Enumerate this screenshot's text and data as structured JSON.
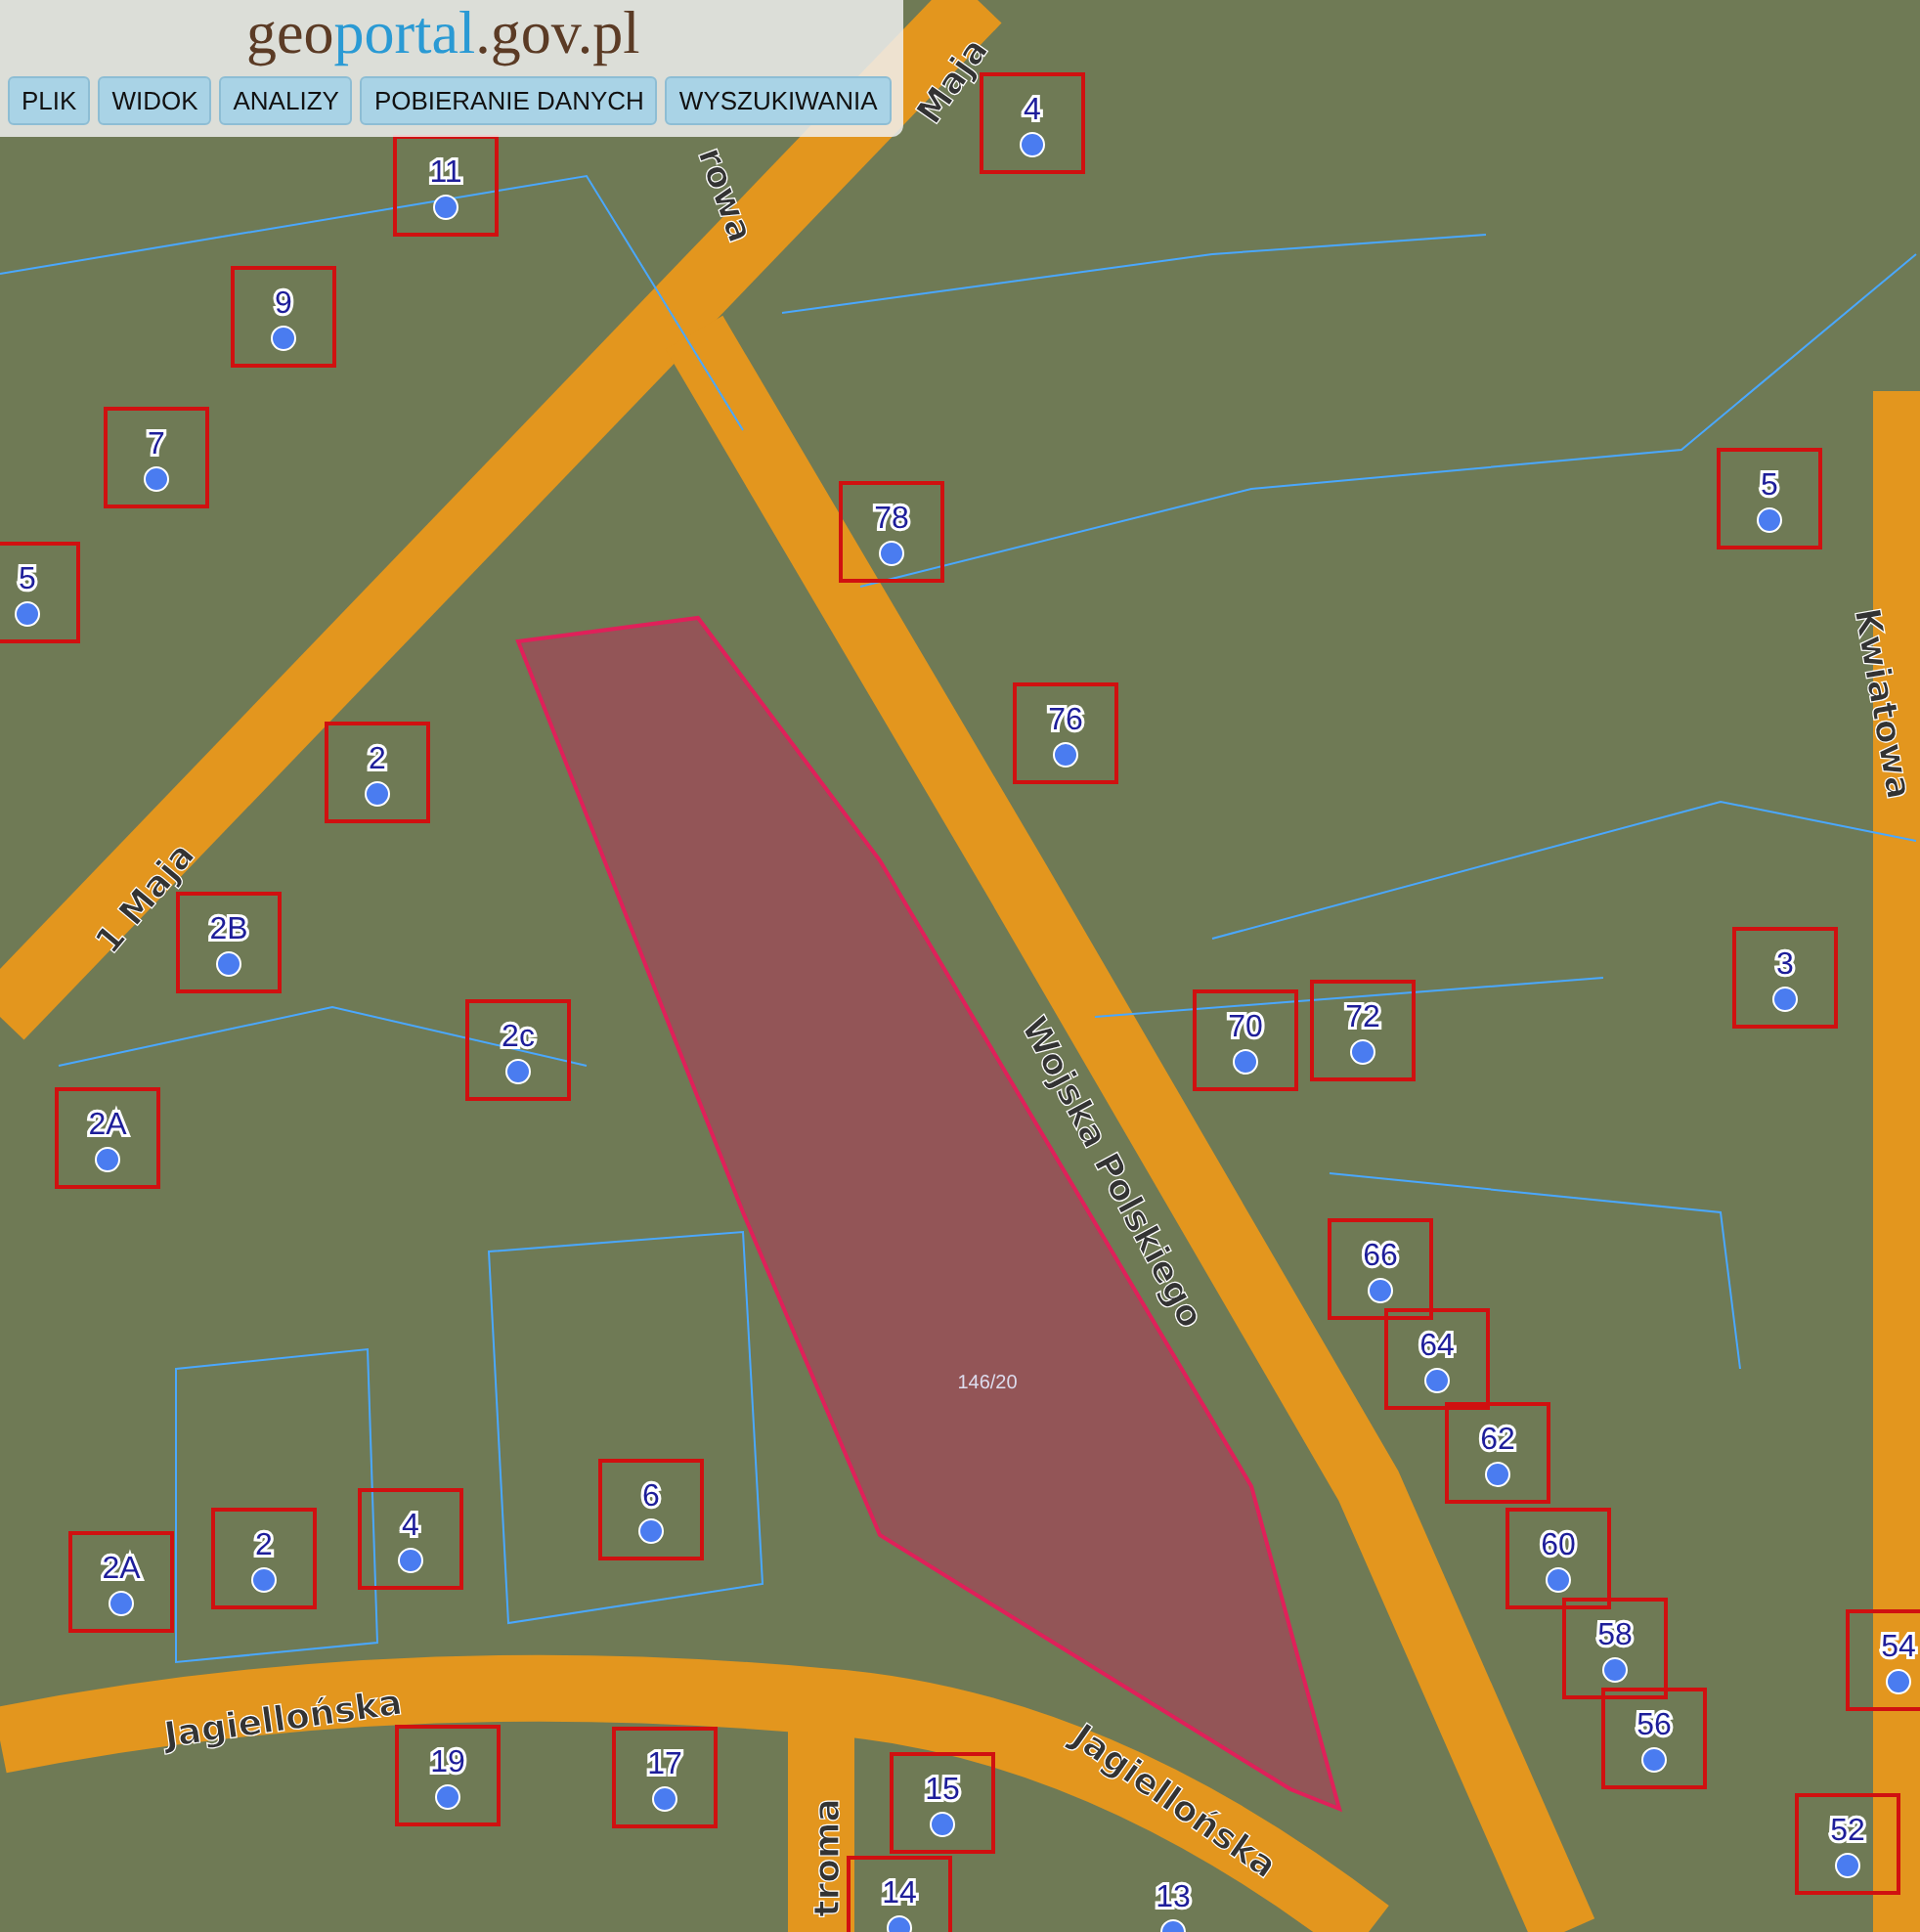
{
  "logo": {
    "parts": [
      "geo",
      "portal",
      ".gov.pl"
    ]
  },
  "menu": [
    {
      "label": "PLIK"
    },
    {
      "label": "WIDOK"
    },
    {
      "label": "ANALIZY"
    },
    {
      "label": "POBIERANIE DANYCH"
    },
    {
      "label": "WYSZUKIWANIA"
    }
  ],
  "map": {
    "streets": [
      "1 Maja",
      "Maja",
      "Wojska Polskiego",
      "Jagiellońska",
      "Jagiellońska",
      "Kwiatowa",
      "troma",
      "rowa"
    ],
    "house_numbers": [
      "11",
      "9",
      "7",
      "5",
      "78",
      "76",
      "5",
      "2",
      "2B",
      "2c",
      "2A",
      "70",
      "72",
      "3",
      "66",
      "64",
      "62",
      "60",
      "58",
      "56",
      "54",
      "52",
      "2A",
      "2",
      "4",
      "6",
      "19",
      "17",
      "15",
      "14",
      "13",
      "4"
    ],
    "parcel": "146/20"
  }
}
